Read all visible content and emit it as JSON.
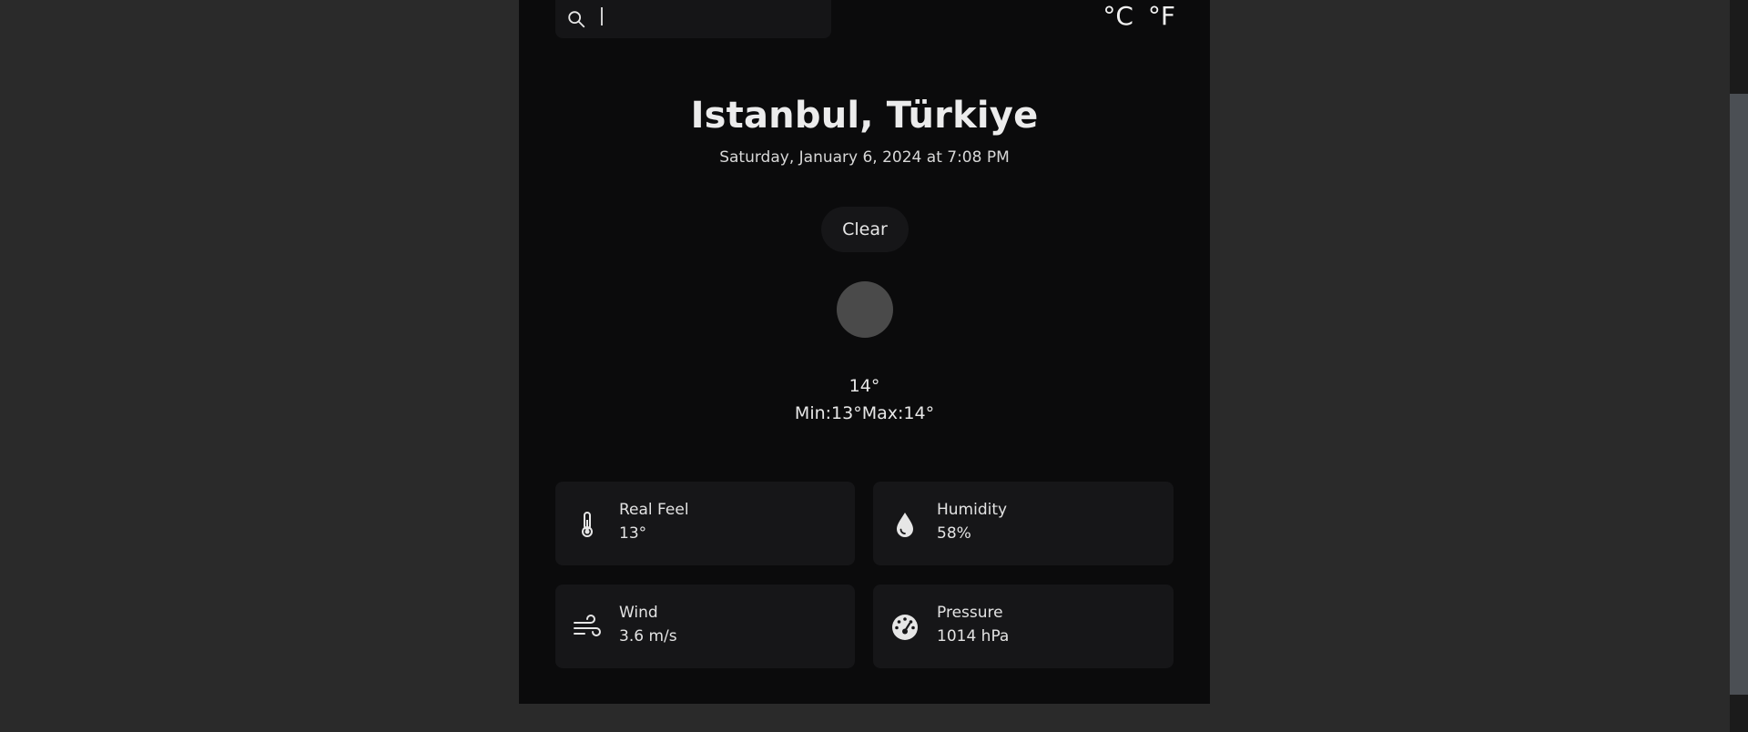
{
  "search": {
    "value": "",
    "placeholder": ""
  },
  "units": {
    "celsius": "°C",
    "fahrenheit": "°F"
  },
  "location": {
    "city": "Istanbul, Türkiye",
    "datetime": "Saturday, January 6, 2024 at 7:08 PM"
  },
  "weather": {
    "condition": "Clear",
    "temperature": "14°",
    "minmax": "Min:13°Max:14°"
  },
  "details": [
    {
      "label": "Real Feel",
      "value": "13°",
      "icon": "thermometer-icon"
    },
    {
      "label": "Humidity",
      "value": "58%",
      "icon": "droplet-icon"
    },
    {
      "label": "Wind",
      "value": "3.6 m/s",
      "icon": "wind-icon"
    },
    {
      "label": "Pressure",
      "value": "1014 hPa",
      "icon": "gauge-icon"
    }
  ]
}
